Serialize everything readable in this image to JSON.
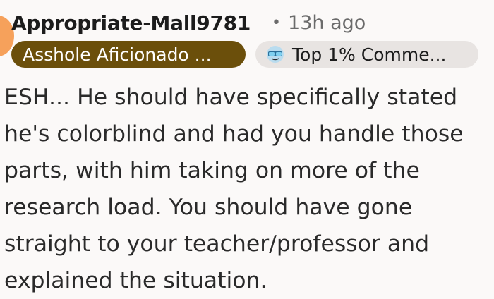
{
  "comment": {
    "author": "Appropriate-Mall9781",
    "separator": "•",
    "timestamp": "13h ago",
    "flair": "Asshole Aficionado ...",
    "badge": {
      "icon": "sunglasses-badge-icon",
      "label": "Top 1% Comme..."
    },
    "body_lines": [
      "ESH... He should have specifically stated",
      "he's colorblind and had you handle those",
      "parts, with him taking on more of the",
      "research load. You should have gone",
      "straight to your teacher/professor and",
      "explained the situation."
    ]
  },
  "colors": {
    "background": "#fbf9f8",
    "avatar": "#f6a15b",
    "flair_bg": "#6b4f0b",
    "badge_bg": "#e8e4e2",
    "meta_text": "#6b6b6b"
  }
}
